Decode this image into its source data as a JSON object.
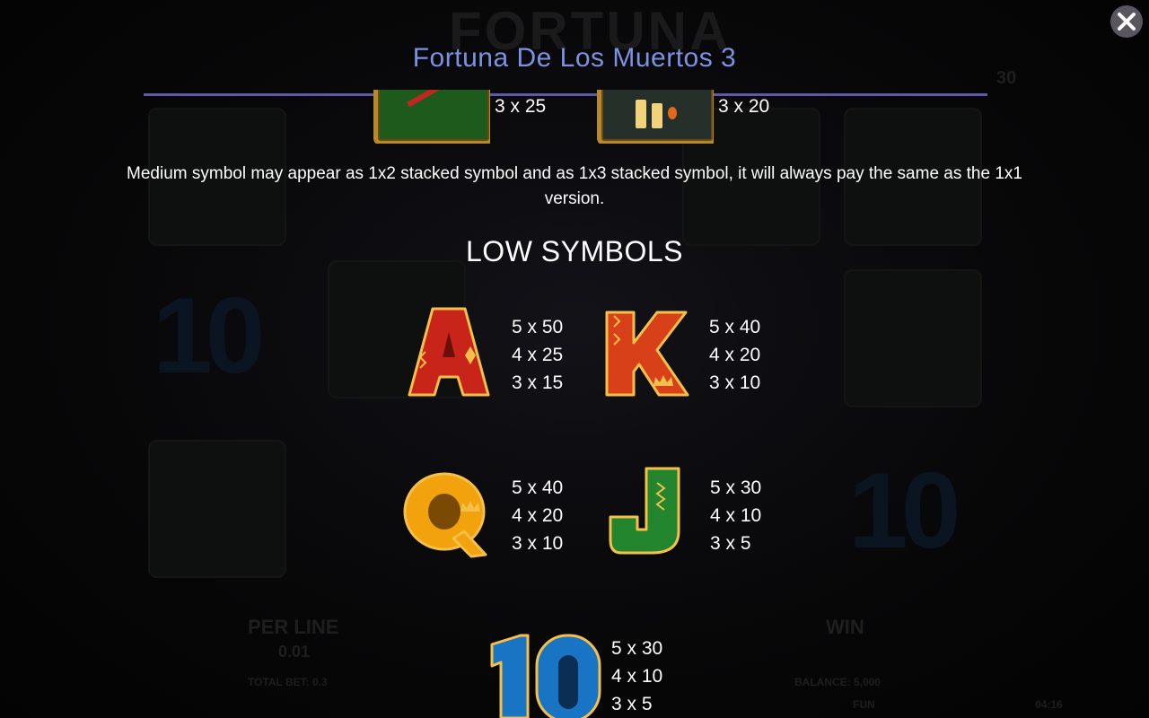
{
  "header": {
    "title": "Fortuna De Los Muertos 3"
  },
  "close_icon": "close-icon",
  "medium_symbols": [
    {
      "name": "medium-symbol-green",
      "pay": "3 x 25"
    },
    {
      "name": "medium-symbol-candles",
      "pay": "3 x 20"
    }
  ],
  "description": "Medium symbol may appear as 1x2 stacked symbol and as 1x3 stacked symbol, it will always pay the same as the 1x1 version.",
  "low_symbols": {
    "title": "LOW SYMBOLS",
    "items": [
      {
        "symbol": "A",
        "pays": [
          "5 x 50",
          "4 x 25",
          "3 x 15"
        ]
      },
      {
        "symbol": "K",
        "pays": [
          "5 x 40",
          "4 x 20",
          "3 x 10"
        ]
      },
      {
        "symbol": "Q",
        "pays": [
          "5 x 40",
          "4 x 20",
          "3 x 10"
        ]
      },
      {
        "symbol": "J",
        "pays": [
          "5 x 30",
          "4 x 10",
          "3 x 5"
        ]
      },
      {
        "symbol": "10",
        "pays": [
          "5 x 30",
          "4 x 10",
          "3 x 5"
        ]
      }
    ]
  },
  "colors": {
    "title": "#7c92e0",
    "rule": "#5d5aa8",
    "symbol_a": "#c8241a",
    "symbol_k": "#d8401a",
    "symbol_q": "#f2a20c",
    "symbol_j": "#23852e",
    "symbol_10": "#1a74c4",
    "gold_outline": "#f3c04a"
  },
  "background": {
    "logo": "FORTUNA",
    "labels": {
      "per_line": "PER LINE",
      "bet_value": "0.01",
      "total_bet": "TOTAL BET: 0.3",
      "win": "WIN",
      "balance": "BALANCE: 5,000",
      "currency": "FUN",
      "clock": "04:16",
      "multiplier": "30"
    },
    "tens": [
      "10",
      "10"
    ]
  }
}
